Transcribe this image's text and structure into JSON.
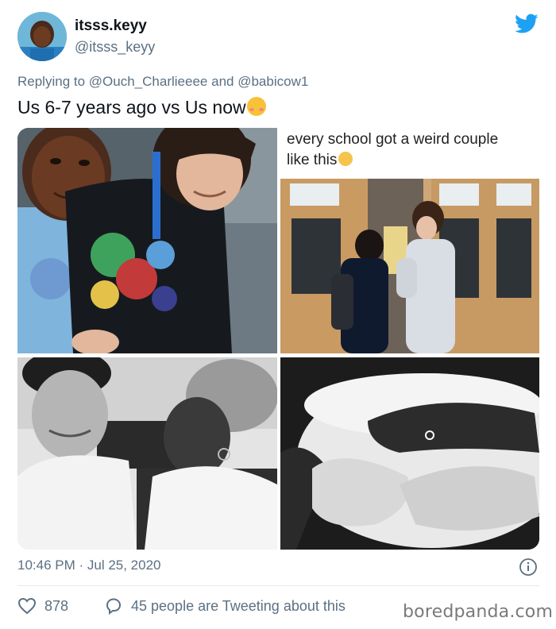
{
  "author": {
    "display_name": "itsss.keyy",
    "handle": "@itsss_keyy"
  },
  "reply": {
    "prefix": "Replying to",
    "mention_1": "@Ouch_Charlieeee",
    "conjunction": "and",
    "mention_2": "@babicow1"
  },
  "tweet_text": "Us 6-7 years ago vs Us now",
  "media": {
    "meme_caption_line1": "every school got a weird couple",
    "meme_caption_line2": "like this"
  },
  "footer": {
    "timestamp": "10:46 PM · Jul 25, 2020",
    "likes_count": "878",
    "conversation_text": "45 people are Tweeting about this"
  },
  "watermark": "boredpanda.com",
  "icons": {
    "logo": "twitter-bird-icon",
    "info": "info-icon",
    "like": "heart-icon",
    "reply": "speech-bubble-icon"
  },
  "colors": {
    "twitter_blue": "#1da1f2",
    "secondary_text": "#5b7083",
    "primary_text": "#0f1419"
  }
}
